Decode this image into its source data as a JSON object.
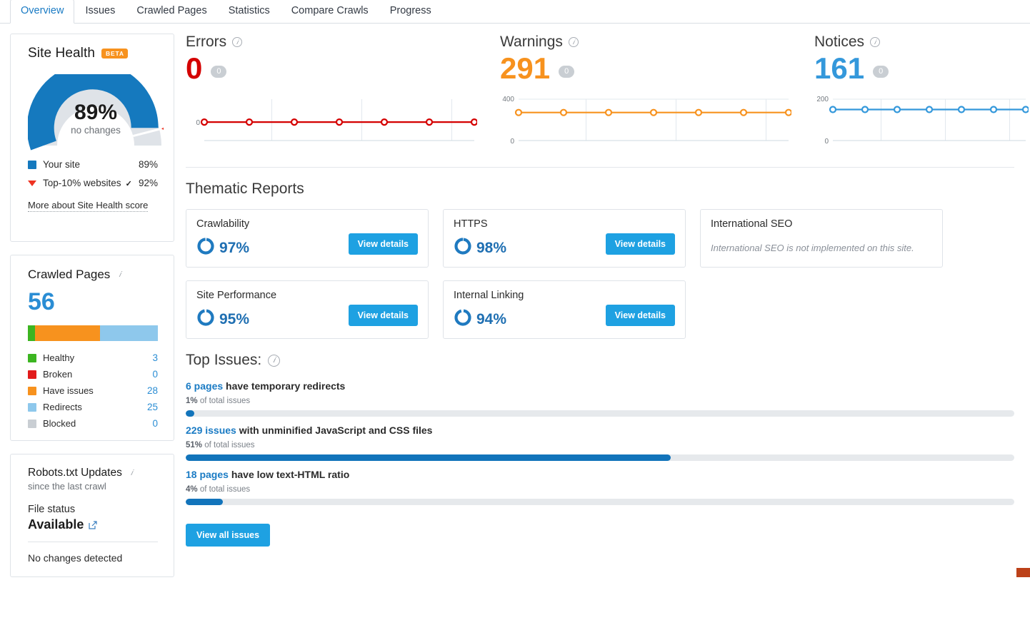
{
  "tabs": [
    {
      "label": "Overview",
      "active": true
    },
    {
      "label": "Issues",
      "active": false
    },
    {
      "label": "Crawled Pages",
      "active": false
    },
    {
      "label": "Statistics",
      "active": false
    },
    {
      "label": "Compare Crawls",
      "active": false
    },
    {
      "label": "Progress",
      "active": false
    }
  ],
  "site_health": {
    "title": "Site Health",
    "badge": "BETA",
    "score": "89%",
    "change_text": "no changes",
    "legend": [
      {
        "label": "Your site",
        "value": "89%",
        "color": "#1579be",
        "marker": "square"
      },
      {
        "label": "Top-10% websites",
        "value": "92%",
        "color": "#e32",
        "marker": "triangle"
      }
    ],
    "more_link": "More about Site Health score"
  },
  "crawled_pages": {
    "title": "Crawled Pages",
    "total": "56",
    "segments": [
      {
        "label": "Healthy",
        "value": "3",
        "color": "#3cb521",
        "pct": 5.4
      },
      {
        "label": "Broken",
        "value": "0",
        "color": "#e21b1b",
        "pct": 0
      },
      {
        "label": "Have issues",
        "value": "28",
        "color": "#f7921e",
        "pct": 50.0
      },
      {
        "label": "Redirects",
        "value": "25",
        "color": "#8ec8ec",
        "pct": 44.6
      },
      {
        "label": "Blocked",
        "value": "0",
        "color": "#c9ced3",
        "pct": 0
      }
    ]
  },
  "robots": {
    "title": "Robots.txt Updates",
    "subtitle": "since the last crawl",
    "file_status_label": "File status",
    "file_status_value": "Available",
    "note": "No changes detected"
  },
  "metrics": [
    {
      "name": "Errors",
      "value": "0",
      "delta": "0",
      "color": "#d40000",
      "axis_top_label": "",
      "axis_bottom_label": "0"
    },
    {
      "name": "Warnings",
      "value": "291",
      "delta": "0",
      "color": "#f7921e",
      "axis_top_label": "400",
      "axis_bottom_label": "0"
    },
    {
      "name": "Notices",
      "value": "161",
      "delta": "0",
      "color": "#3498db",
      "axis_top_label": "200",
      "axis_bottom_label": "0"
    }
  ],
  "chart_data": [
    {
      "type": "line",
      "title": "Errors",
      "x": [
        1,
        2,
        3,
        4,
        5,
        6,
        7
      ],
      "values": [
        0,
        0,
        0,
        0,
        0,
        0,
        0
      ],
      "ylim": [
        0,
        0
      ],
      "ytick_labels": [
        "0"
      ],
      "color": "#d40000",
      "grid": true,
      "xlabel": "",
      "ylabel": ""
    },
    {
      "type": "line",
      "title": "Warnings",
      "x": [
        1,
        2,
        3,
        4,
        5,
        6,
        7
      ],
      "values": [
        291,
        291,
        291,
        291,
        291,
        291,
        291
      ],
      "ylim": [
        0,
        400
      ],
      "ytick_labels": [
        "400",
        "0"
      ],
      "color": "#f7921e",
      "grid": true,
      "xlabel": "",
      "ylabel": ""
    },
    {
      "type": "line",
      "title": "Notices",
      "x": [
        1,
        2,
        3,
        4,
        5,
        6,
        7
      ],
      "values": [
        161,
        161,
        161,
        161,
        161,
        161,
        161
      ],
      "ylim": [
        0,
        200
      ],
      "ytick_labels": [
        "200",
        "0"
      ],
      "color": "#3498db",
      "grid": true,
      "xlabel": "",
      "ylabel": ""
    },
    {
      "type": "pie",
      "title": "Site Health",
      "categories": [
        "Your site",
        "Remaining"
      ],
      "values": [
        89,
        11
      ],
      "benchmark": 92,
      "benchmark_label": "Top-10% websites"
    },
    {
      "type": "bar",
      "title": "Crawled Pages",
      "categories": [
        "Healthy",
        "Broken",
        "Have issues",
        "Redirects",
        "Blocked"
      ],
      "values": [
        3,
        0,
        28,
        25,
        0
      ],
      "total": 56
    }
  ],
  "thematic": {
    "title": "Thematic Reports",
    "view_details_label": "View details",
    "cards": [
      {
        "name": "Crawlability",
        "pct": "97%",
        "pct_num": 97,
        "empty": false
      },
      {
        "name": "HTTPS",
        "pct": "98%",
        "pct_num": 98,
        "empty": false
      },
      {
        "name": "International SEO",
        "pct": "",
        "pct_num": 0,
        "empty": true,
        "empty_text": "International SEO is not implemented on this site."
      },
      {
        "name": "Site Performance",
        "pct": "95%",
        "pct_num": 95,
        "empty": false
      },
      {
        "name": "Internal Linking",
        "pct": "94%",
        "pct_num": 94,
        "empty": false
      }
    ]
  },
  "top_issues": {
    "title": "Top Issues:",
    "items": [
      {
        "count": "6 pages",
        "text": " have temporary redirects",
        "sub_pct": "1%",
        "sub_rest": " of total issues",
        "bar_pct": 1
      },
      {
        "count": "229 issues",
        "text": " with unminified JavaScript and CSS files",
        "sub_pct": "51%",
        "sub_rest": " of total issues",
        "bar_pct": 58.5
      },
      {
        "count": "18 pages",
        "text": " have low text-HTML ratio",
        "sub_pct": "4%",
        "sub_rest": " of total issues",
        "bar_pct": 4.5
      }
    ],
    "view_all_label": "View all issues"
  }
}
